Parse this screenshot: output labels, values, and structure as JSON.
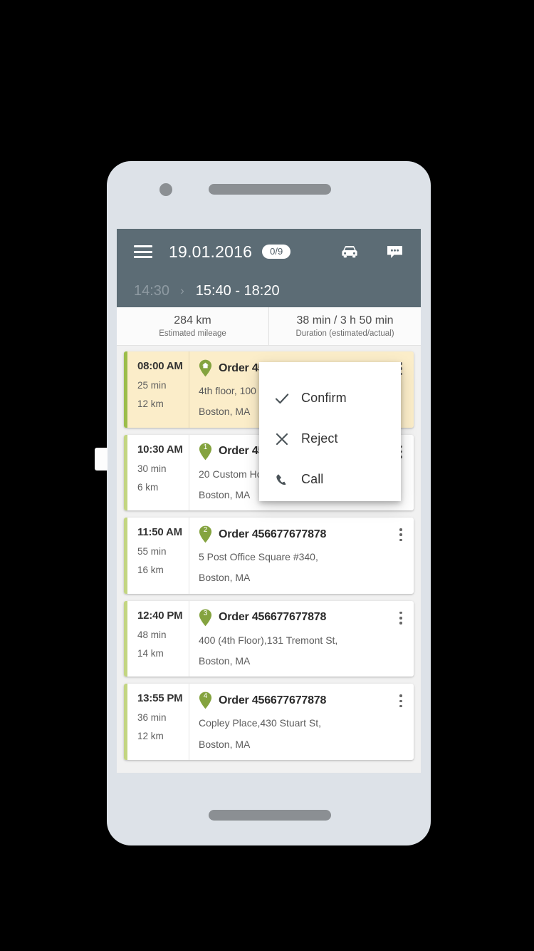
{
  "appbar": {
    "menu_icon": "hamburger-icon",
    "date": "19.01.2016",
    "count_badge": "0/9",
    "car_icon": "car-icon",
    "chat_icon": "chat-icon",
    "previous_time": "14:30",
    "arrow": "›",
    "current_window": "15:40 - 18:20",
    "bg_color": "#5c6c75"
  },
  "stats": [
    {
      "value": "284 km",
      "label": "Estimated mileage"
    },
    {
      "value": "38 min / 3 h 50 min",
      "label": "Duration (estimated/actual)"
    }
  ],
  "orders": [
    {
      "time": "08:00 AM",
      "duration": "25 min",
      "distance": "12 km",
      "pin": "home",
      "pin_label": "",
      "title": "Order 456677677878",
      "address_line1": "4th floor, 100 Summer St,",
      "address_line2": "Boston, MA",
      "highlighted": true
    },
    {
      "time": "10:30 AM",
      "duration": "30 min",
      "distance": "6 km",
      "pin": "number",
      "pin_label": "1",
      "title": "Order 456677677878",
      "address_line1": "20 Custom House St,",
      "address_line2": "Boston, MA",
      "highlighted": false
    },
    {
      "time": "11:50 AM",
      "duration": "55 min",
      "distance": "16 km",
      "pin": "number",
      "pin_label": "2",
      "title": "Order 456677677878",
      "address_line1": "5 Post Office Square #340,",
      "address_line2": "Boston, MA",
      "highlighted": false
    },
    {
      "time": "12:40 PM",
      "duration": "48 min",
      "distance": "14 km",
      "pin": "number",
      "pin_label": "3",
      "title": "Order 456677677878",
      "address_line1": "400 (4th Floor),131 Tremont St,",
      "address_line2": "Boston, MA",
      "highlighted": false
    },
    {
      "time": "13:55 PM",
      "duration": "36 min",
      "distance": "12 km",
      "pin": "number",
      "pin_label": "4",
      "title": "Order 456677677878",
      "address_line1": "Copley Place,430 Stuart St,",
      "address_line2": "Boston, MA",
      "highlighted": false
    }
  ],
  "popup": {
    "items": [
      {
        "label": "Confirm",
        "icon": "check-icon"
      },
      {
        "label": "Reject",
        "icon": "close-icon"
      },
      {
        "label": "Call",
        "icon": "phone-icon"
      }
    ]
  },
  "colors": {
    "appbar": "#5c6c75",
    "highlight_row": "#fbedc9",
    "stripe": "#c3d581",
    "stripe_active": "#9bbd4a",
    "pin_green": "#84a33f",
    "phone_body": "#dde2e8"
  }
}
